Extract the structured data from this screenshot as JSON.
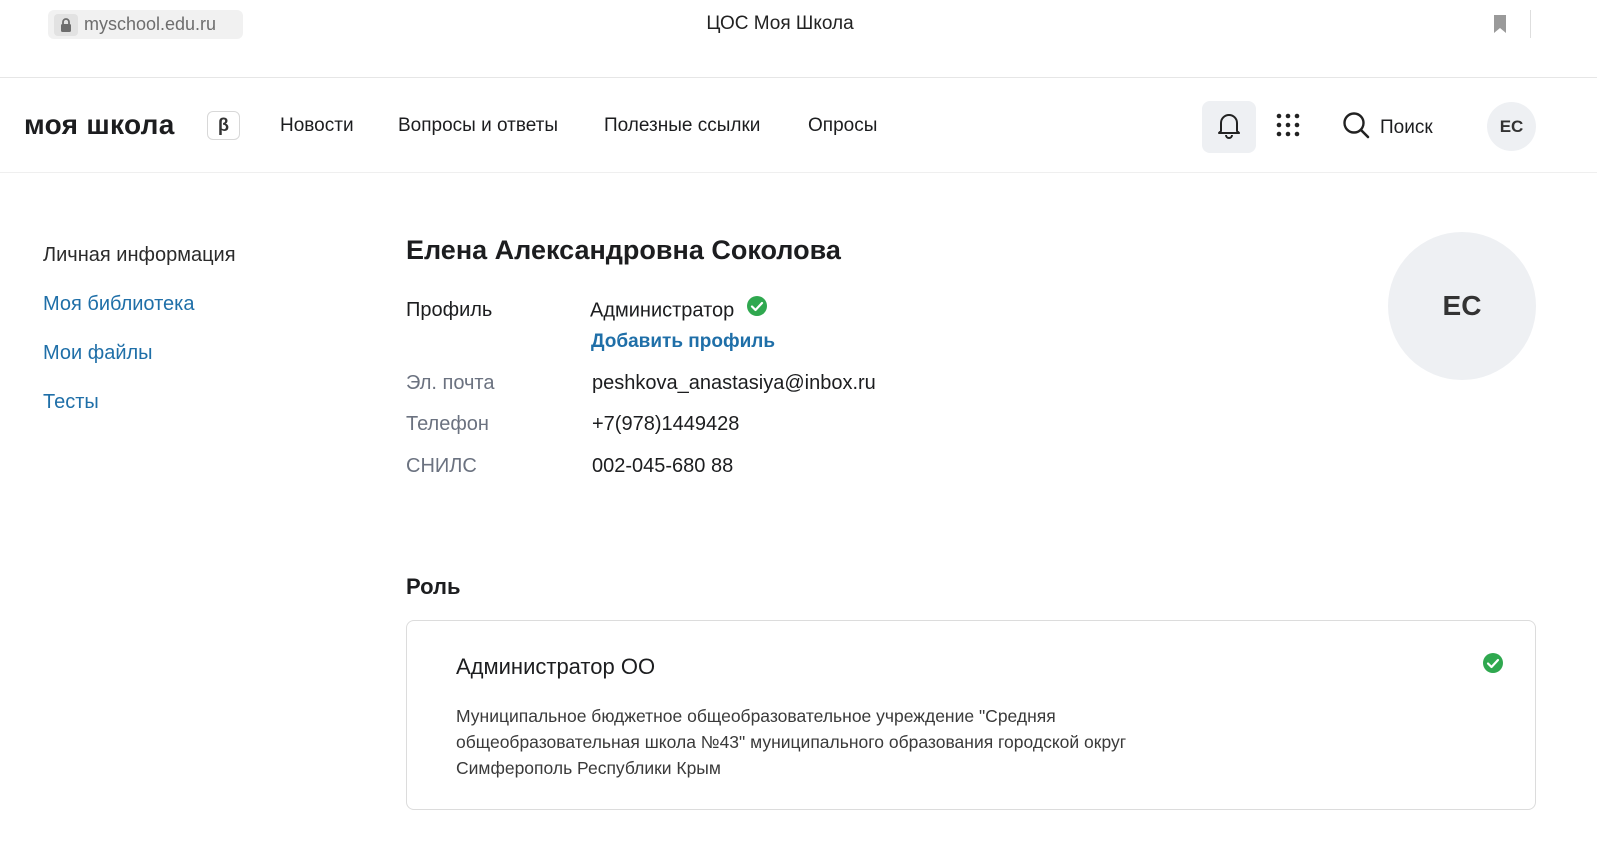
{
  "browser": {
    "url": "myschool.edu.ru",
    "tab_title": "ЦОС Моя Школа"
  },
  "header": {
    "logo": "моя школа",
    "beta": "β",
    "nav": [
      "Новости",
      "Вопросы и ответы",
      "Полезные ссылки",
      "Опросы"
    ],
    "search_label": "Поиск",
    "avatar_initials": "ЕС"
  },
  "sidebar": {
    "items": [
      {
        "label": "Личная информация",
        "active": true
      },
      {
        "label": "Моя библиотека",
        "active": false
      },
      {
        "label": "Мои файлы",
        "active": false
      },
      {
        "label": "Тесты",
        "active": false
      }
    ]
  },
  "profile": {
    "name": "Елена Александровна Соколова",
    "profile_label": "Профиль",
    "profile_value": "Администратор",
    "add_profile": "Добавить профиль",
    "email_label": "Эл. почта",
    "email_value": "peshkova_anastasiya@inbox.ru",
    "phone_label": "Телефон",
    "phone_value": "+7(978)1449428",
    "snils_label": "СНИЛС",
    "snils_value": "002-045-680 88",
    "avatar_initials": "ЕС"
  },
  "role": {
    "section_title": "Роль",
    "title": "Администратор ОО",
    "description": "Муниципальное бюджетное общеобразовательное учреждение \"Средняя общеобразовательная школа №43\" муниципального образования городской округ Симферополь Республики Крым"
  },
  "colors": {
    "link": "#1f6fa8",
    "check": "#2fa84f",
    "muted": "#6b7280"
  }
}
